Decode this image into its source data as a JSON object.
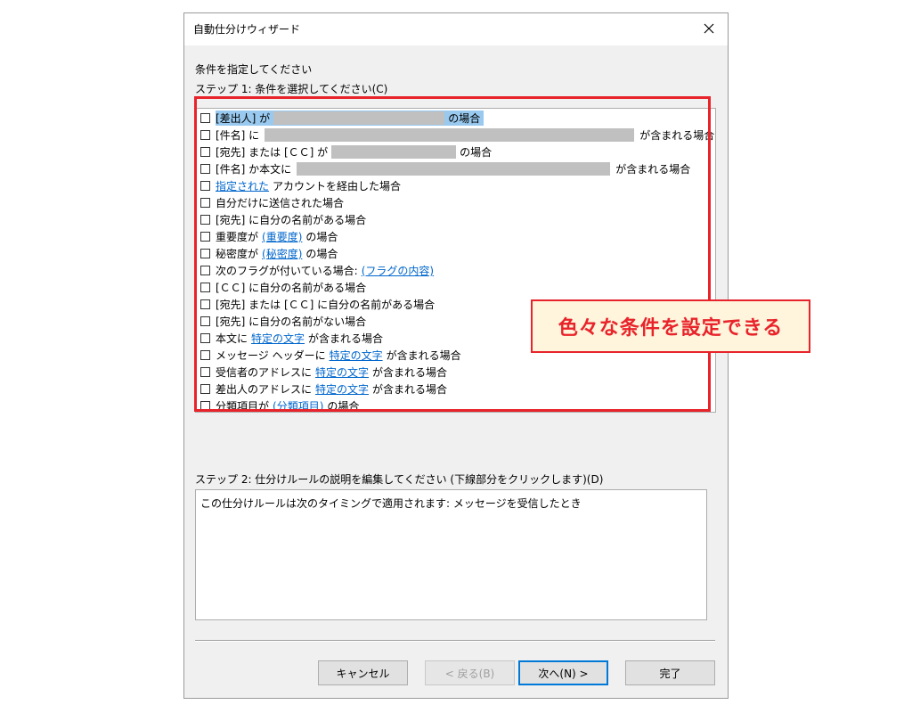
{
  "dialog": {
    "title": "自動仕分けウィザード",
    "instruction": "条件を指定してください",
    "step1_label": "ステップ 1: 条件を選択してください(C)",
    "step2_label": "ステップ 2: 仕分けルールの説明を編集してください (下線部分をクリックします)(D)",
    "description": "この仕分けルールは次のタイミングで適用されます: メッセージを受信したとき"
  },
  "conditions": {
    "c0": {
      "a": "[差出人] が",
      "b": "の場合"
    },
    "c1": {
      "a": "[件名] に",
      "b": "が含まれる場合"
    },
    "c2": {
      "a": "[宛先] または [ＣＣ] が",
      "b": "の場合"
    },
    "c3": {
      "a": "[件名] か本文に",
      "b": "が含まれる場合"
    },
    "c4": {
      "link": "指定された",
      "b": "アカウントを経由した場合"
    },
    "c5": {
      "a": "自分だけに送信された場合"
    },
    "c6": {
      "a": "[宛先] に自分の名前がある場合"
    },
    "c7": {
      "a": "重要度が",
      "link": "(重要度)",
      "b": "の場合"
    },
    "c8": {
      "a": "秘密度が",
      "link": "(秘密度)",
      "b": "の場合"
    },
    "c9": {
      "a": "次のフラグが付いている場合:",
      "link": "(フラグの内容)"
    },
    "c10": {
      "a": "[ＣＣ] に自分の名前がある場合"
    },
    "c11": {
      "a": "[宛先] または [ＣＣ] に自分の名前がある場合"
    },
    "c12": {
      "a": "[宛先] に自分の名前がない場合"
    },
    "c13": {
      "a": "本文に",
      "link": "特定の文字",
      "b": "が含まれる場合"
    },
    "c14": {
      "a": "メッセージ ヘッダーに",
      "link": "特定の文字",
      "b": "が含まれる場合"
    },
    "c15": {
      "a": "受信者のアドレスに",
      "link": "特定の文字",
      "b": "が含まれる場合"
    },
    "c16": {
      "a": "差出人のアドレスに",
      "link": "特定の文字",
      "b": "が含まれる場合"
    },
    "c17": {
      "a": "分類項目が",
      "link": "(分類項目)",
      "b": "の場合"
    }
  },
  "callout": "色々な条件を設定できる",
  "buttons": {
    "cancel": "キャンセル",
    "back": "< 戻る(B)",
    "next": "次へ(N) >",
    "finish": "完了"
  },
  "colors": {
    "highlight_red": "#e8232a",
    "callout_bg": "#fff4dc",
    "selection": "#99c9ef",
    "link": "#0066cc"
  }
}
